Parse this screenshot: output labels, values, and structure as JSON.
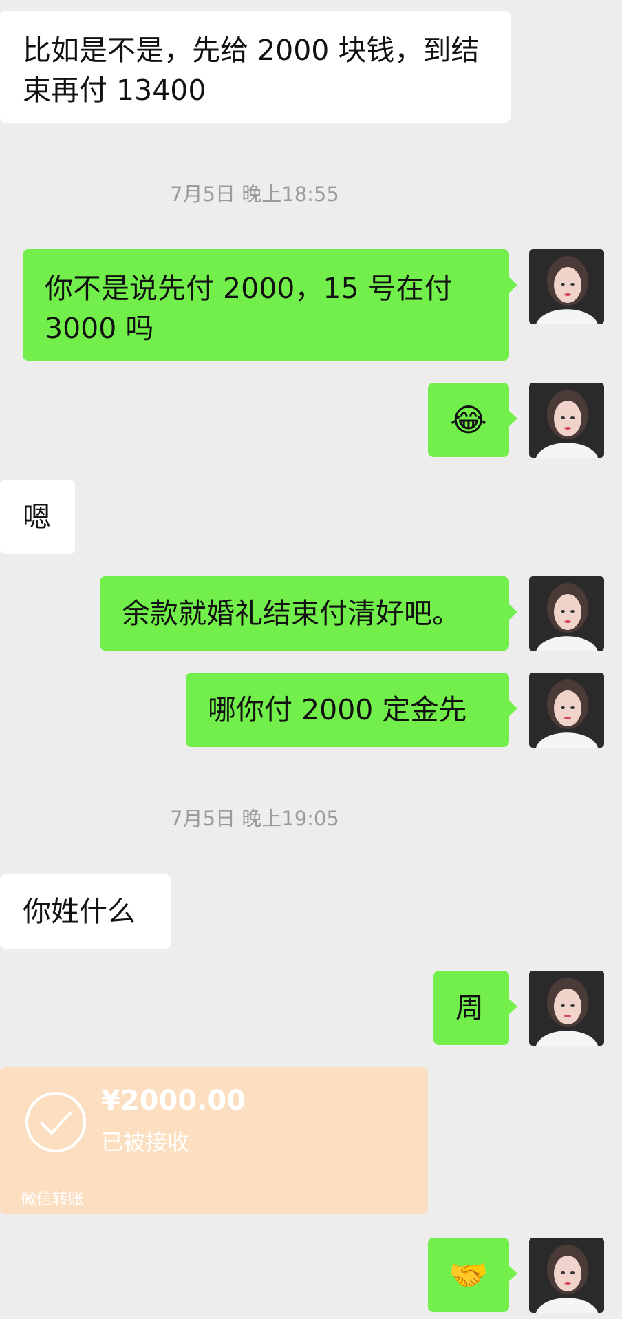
{
  "messages": {
    "m1": "比如是不是，先给 2000 块钱，到结束再付 13400",
    "m2": "你不是说先付 2000，15 号在付3000 吗",
    "m3_emoji": "😂",
    "m4": "嗯",
    "m5": "余款就婚礼结束付清好吧。",
    "m6": "哪你付 2000 定金先",
    "m7": "你姓什么",
    "m8": "周",
    "m9_emoji": "🤝"
  },
  "timestamps": {
    "t1": "7月5日 晚上18:55",
    "t2": "7月5日 晚上19:05"
  },
  "transfer": {
    "amount": "¥2000.00",
    "status": "已被接收",
    "label": "微信转账"
  },
  "colors": {
    "background": "#ededed",
    "incoming_bubble": "#ffffff",
    "outgoing_bubble": "#72ef4a",
    "transfer_card": "#fcdfc0",
    "timestamp_text": "#9b9b9b"
  },
  "icons": {
    "avatar": "user-avatar-photo",
    "transfer_status": "check-circle-icon"
  }
}
